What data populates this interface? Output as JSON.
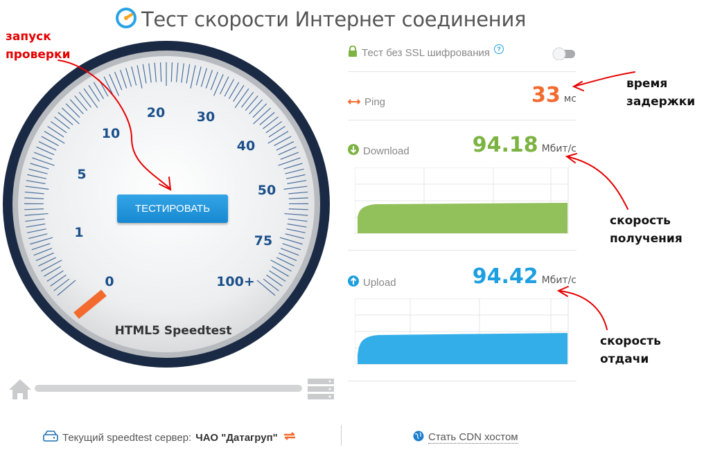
{
  "title": "Тест скорости Интернет соединения",
  "annotations": {
    "start": [
      "запуск",
      "проверки"
    ],
    "latency": [
      "время",
      "задержки"
    ],
    "download": [
      "скорость",
      "получения"
    ],
    "upload": [
      "скорость",
      "отдачи"
    ]
  },
  "gauge": {
    "ticks": [
      "0",
      "1",
      "5",
      "10",
      "20",
      "30",
      "40",
      "50",
      "75",
      "100+"
    ],
    "button_label": "ТЕСТИРОВАТЬ",
    "caption": "HTML5 Speedtest"
  },
  "ssl": {
    "label": "Тест без SSL шифрования",
    "help_icon": "?",
    "enabled": false
  },
  "ping": {
    "label": "Ping",
    "value": "33",
    "unit": "мс"
  },
  "download": {
    "label": "Download",
    "value": "94.18",
    "unit": "Мбит/с",
    "color": "#7cb342",
    "fill": "#92c05b"
  },
  "upload": {
    "label": "Upload",
    "value": "94.42",
    "unit": "Мбит/с",
    "color": "#1e9fe0",
    "fill": "#34aee9"
  },
  "footer": {
    "server_label": "Текущий speedtest сервер:",
    "server_name": "ЧАО \"Датагруп\"",
    "cdn_label": "Стать CDN хостом"
  },
  "colors": {
    "accent_orange": "#f26a2e",
    "dark_navy": "#1b2a44",
    "tick_blue": "#1a4f8a",
    "annotation_red": "#e60000"
  }
}
